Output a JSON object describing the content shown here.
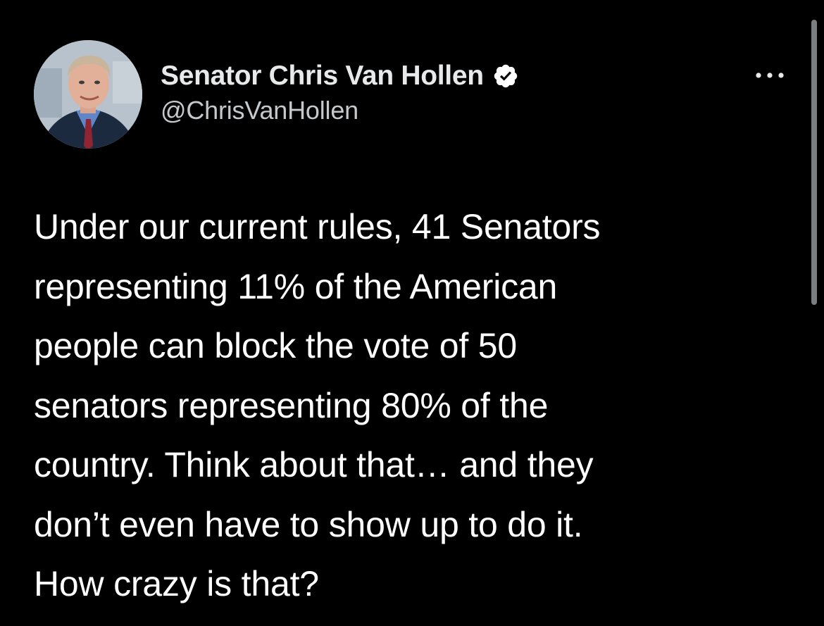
{
  "tweet": {
    "author": {
      "display_name": "Senator Chris Van Hollen",
      "handle": "@ChrisVanHollen",
      "verified": true,
      "avatar_icon": "profile-photo",
      "verified_icon": "verified-badge-icon"
    },
    "menu": {
      "more_icon": "more-horizontal-icon"
    },
    "text_lines": [
      "Under our current rules, 41 Senators",
      "representing 11% of the American",
      "people can block the vote of 50",
      "senators representing 80% of the",
      "country. Think about that… and they",
      "don’t even have to show up to do it.",
      "How crazy is that?"
    ]
  },
  "colors": {
    "background": "#000000",
    "text_primary": "#ffffff",
    "text_secondary": "#c5c9cc",
    "scrollbar": "#7b7e81"
  }
}
